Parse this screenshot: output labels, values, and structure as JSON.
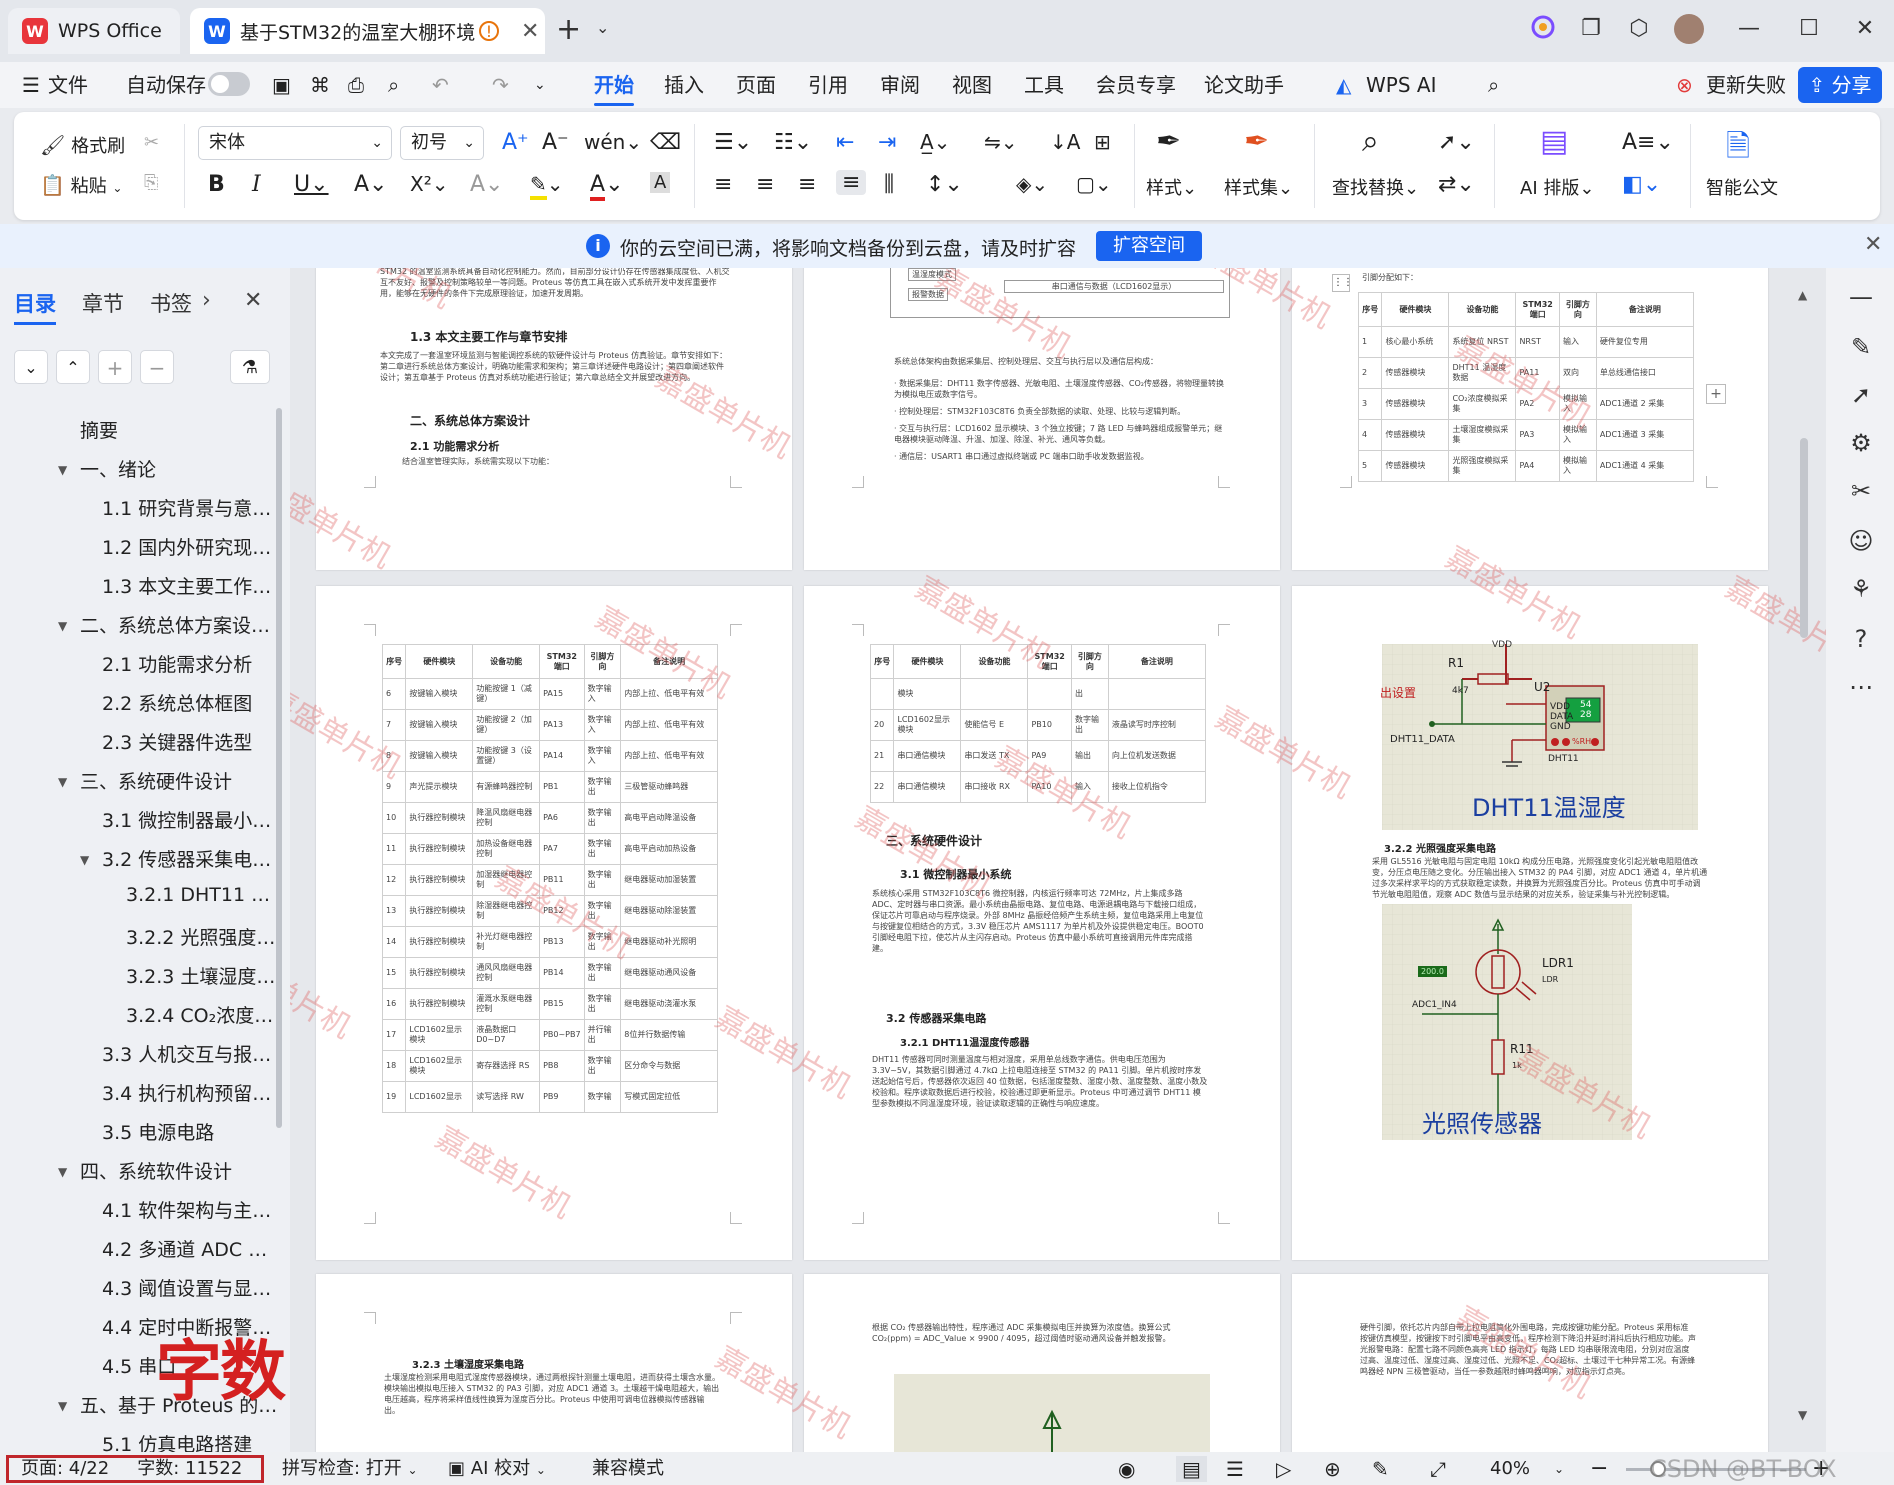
{
  "titlebar": {
    "app_tab_label": "WPS Office",
    "doc_tab_label": "基于STM32的温室大棚环境",
    "new_tab_symbol": "+",
    "dropdown_symbol": "⌄",
    "brand_color": "#e8353b",
    "doc_icon_color": "#1a64f0"
  },
  "menubar": {
    "file_label": "文件",
    "autosave_label": "自动保存",
    "items": [
      "开始",
      "插入",
      "页面",
      "引用",
      "审阅",
      "视图",
      "工具",
      "会员专享",
      "论文助手"
    ],
    "active_item": "开始",
    "wps_ai_label": "WPS AI",
    "update_fail_label": "更新失败",
    "share_label": "分享"
  },
  "ribbon": {
    "format_painter_label": "格式刷",
    "paste_label": "粘贴",
    "font_name": "宋体",
    "font_size": "初号",
    "styles_label": "样式",
    "style_set_label": "样式集",
    "find_replace_label": "查找替换",
    "ai_layout_label": "AI 排版",
    "smart_doc_label": "智能公文"
  },
  "notice": {
    "message": "你的云空间已满，将影响文档备份到云盘，请及时扩容",
    "action_label": "扩容空间"
  },
  "sidebar": {
    "tabs": [
      "目录",
      "章节",
      "书签"
    ],
    "active_tab": "目录",
    "toc": [
      {
        "label": "摘要",
        "level": 0,
        "expander": ""
      },
      {
        "label": "一、绪论",
        "level": 0,
        "expander": "▼"
      },
      {
        "label": "1.1 研究背景与意…",
        "level": 1,
        "expander": ""
      },
      {
        "label": "1.2 国内外研究现…",
        "level": 1,
        "expander": ""
      },
      {
        "label": "1.3 本文主要工作…",
        "level": 1,
        "expander": ""
      },
      {
        "label": "二、系统总体方案设…",
        "level": 0,
        "expander": "▼"
      },
      {
        "label": "2.1 功能需求分析",
        "level": 1,
        "expander": ""
      },
      {
        "label": "2.2 系统总体框图",
        "level": 1,
        "expander": ""
      },
      {
        "label": "2.3 关键器件选型",
        "level": 1,
        "expander": ""
      },
      {
        "label": "三、系统硬件设计",
        "level": 0,
        "expander": "▼"
      },
      {
        "label": "3.1 微控制器最小…",
        "level": 1,
        "expander": ""
      },
      {
        "label": "3.2 传感器采集电…",
        "level": 1,
        "expander": "▼"
      },
      {
        "label": "3.2.1 DHT11 …",
        "level": 2,
        "expander": ""
      },
      {
        "label": "3.2.2 光照强度…",
        "level": 2,
        "expander": ""
      },
      {
        "label": "3.2.3 土壤湿度…",
        "level": 2,
        "expander": ""
      },
      {
        "label": "3.2.4 CO₂浓度…",
        "level": 2,
        "expander": ""
      },
      {
        "label": "3.3 人机交互与报…",
        "level": 1,
        "expander": ""
      },
      {
        "label": "3.4 执行机构预留…",
        "level": 1,
        "expander": ""
      },
      {
        "label": "3.5 电源电路",
        "level": 1,
        "expander": ""
      },
      {
        "label": "四、系统软件设计",
        "level": 0,
        "expander": "▼"
      },
      {
        "label": "4.1 软件架构与主…",
        "level": 1,
        "expander": ""
      },
      {
        "label": "4.2 多通道 ADC …",
        "level": 1,
        "expander": ""
      },
      {
        "label": "4.3 阈值设置与显…",
        "level": 1,
        "expander": ""
      },
      {
        "label": "4.4 定时中断报警…",
        "level": 1,
        "expander": ""
      },
      {
        "label": "4.5 串口",
        "level": 1,
        "expander": ""
      },
      {
        "label": "五、基于 Proteus 的…",
        "level": 0,
        "expander": "▼"
      },
      {
        "label": "5.1 仿真电路搭建",
        "level": 1,
        "expander": ""
      }
    ],
    "word_count_overlay": "字数11522",
    "overlay_color": "#d42020"
  },
  "document": {
    "p1": {
      "heading_13": "1.3 本文主要工作与章节安排",
      "heading_2": "二、系统总体方案设计",
      "heading_21": "2.1 功能需求分析",
      "line_21": "结合温室管理实际，系统需实现以下功能："
    },
    "p2": {
      "box1": "温湿度模式",
      "box2": "报警数据",
      "box3": "串口通信与数据（LCD1602显示）",
      "summary": "系统总体架构由数据采集层、控制处理层、交互与执行层以及通信层构成：",
      "bullets": [
        "· 数据采集层：DHT11 数字传感器、光敏电阻、土壤湿度传感器、CO₂传感器，将物理量转换为模拟电压或数字信号。",
        "· 控制处理层：STM32F103C8T6 负责全部数据的读取、处理、比较与逻辑判断。",
        "· 交互与执行层：LCD1602 显示模块、3 个独立按键；7 路 LED 与蜂鸣器组成报警单元；继电器模块驱动降温、升温、加湿、除湿、补光、通风等负载。",
        "· 通信层：USART1 串口通过虚拟终端或 PC 端串口助手收发数据监视。"
      ]
    },
    "p3": {
      "intro": "引脚分配如下：",
      "headers": [
        "序号",
        "硬件模块",
        "设备功能",
        "STM32端口",
        "引脚方向",
        "备注说明"
      ],
      "rows": [
        [
          "1",
          "核心最小系统",
          "系统复位 NRST",
          "NRST",
          "输入",
          "硬件复位专用"
        ],
        [
          "2",
          "传感器模块",
          "DHT11 温湿度数据",
          "PA11",
          "双向",
          "单总线通信接口"
        ],
        [
          "3",
          "传感器模块",
          "CO₂浓度模拟采集",
          "PA2",
          "模拟输入",
          "ADC1通道 2 采集"
        ],
        [
          "4",
          "传感器模块",
          "土壤湿度模拟采集",
          "PA3",
          "模拟输入",
          "ADC1通道 3 采集"
        ],
        [
          "5",
          "传感器模块",
          "光照强度模拟采集",
          "PA4",
          "模拟输入",
          "ADC1通道 4 采集"
        ]
      ]
    },
    "p4": {
      "headers": [
        "序号",
        "硬件模块",
        "设备功能",
        "STM32端口",
        "引脚方向",
        "备注说明"
      ],
      "rows": [
        [
          "6",
          "按键输入模块",
          "功能按键 1（减键）",
          "PA15",
          "数字输入",
          "内部上拉、低电平有效"
        ],
        [
          "7",
          "按键输入模块",
          "功能按键 2（加键）",
          "PA13",
          "数字输入",
          "内部上拉、低电平有效"
        ],
        [
          "8",
          "按键输入模块",
          "功能按键 3（设置键）",
          "PA14",
          "数字输入",
          "内部上拉、低电平有效"
        ],
        [
          "9",
          "声光提示模块",
          "有源蜂鸣器控制",
          "PB1",
          "数字输出",
          "三极管驱动蜂鸣器"
        ],
        [
          "10",
          "执行器控制模块",
          "降温风扇继电器控制",
          "PA6",
          "数字输出",
          "高电平启动降温设备"
        ],
        [
          "11",
          "执行器控制模块",
          "加热设备继电器控制",
          "PA7",
          "数字输出",
          "高电平启动加热设备"
        ],
        [
          "12",
          "执行器控制模块",
          "加湿器继电器控制",
          "PB11",
          "数字输出",
          "继电器驱动加湿装置"
        ],
        [
          "13",
          "执行器控制模块",
          "除湿器继电器控制",
          "PB12",
          "数字输出",
          "继电器驱动除湿装置"
        ],
        [
          "14",
          "执行器控制模块",
          "补光灯继电器控制",
          "PB13",
          "数字输出",
          "继电器驱动补光照明"
        ],
        [
          "15",
          "执行器控制模块",
          "通风风扇继电器控制",
          "PB14",
          "数字输出",
          "继电器驱动通风设备"
        ],
        [
          "16",
          "执行器控制模块",
          "灌溉水泵继电器控制",
          "PB15",
          "数字输出",
          "继电器驱动浇灌水泵"
        ],
        [
          "17",
          "LCD1602显示模块",
          "液晶数据口 D0~D7",
          "PB0~PB7",
          "并行输出",
          "8位并行数据传输"
        ],
        [
          "18",
          "LCD1602显示模块",
          "寄存器选择 RS",
          "PB8",
          "数字输出",
          "区分命令与数据"
        ],
        [
          "19",
          "LCD1602显示",
          "读写选择 RW",
          "PB9",
          "数字输",
          "写模式固定拉低"
        ]
      ]
    },
    "p5": {
      "headers": [
        "序号",
        "硬件模块",
        "设备功能",
        "STM32端口",
        "引脚方向",
        "备注说明"
      ],
      "rows": [
        [
          "",
          "模块",
          "",
          "",
          "出",
          ""
        ],
        [
          "20",
          "LCD1602显示模块",
          "使能信号 E",
          "PB10",
          "数字输出",
          "液晶读写时序控制"
        ],
        [
          "21",
          "串口通信模块",
          "串口发送 TX",
          "PA9",
          "输出",
          "向上位机发送数据"
        ],
        [
          "22",
          "串口通信模块",
          "串口接收 RX",
          "PA10",
          "输入",
          "接收上位机指令"
        ]
      ],
      "heading_3": "三、系统硬件设计",
      "heading_31": "3.1 微控制器最小系统",
      "heading_32": "3.2 传感器采集电路",
      "heading_321": "3.2.1 DHT11温湿度传感器"
    },
    "p6": {
      "schem_vdd": "VDD",
      "schem_r1": "R1",
      "schem_r1_val": "4k7",
      "schem_u2": "U2",
      "schem_pins": [
        "VDD",
        "DATA",
        "GND"
      ],
      "schem_dht_label": "DHT11",
      "schem_net": "DHT11_DATA",
      "schem_setting": "出设置",
      "schem_reading_1": "54",
      "schem_reading_2": "28",
      "schem_rh": "%RH",
      "caption_dht": "DHT11温湿度",
      "heading_322": "3.2.2 光照强度采集电路",
      "ldr_label": "LDR1",
      "ldr_sub": "LDR",
      "ldr_value": "200.0",
      "adc_net": "ADC1_IN4",
      "r11": "R11",
      "r11_val": "1k",
      "caption_light": "光照传感器"
    },
    "p7": {
      "heading_323": "3.2.3 土壤湿度采集电路"
    },
    "watermark_text": "嘉盛单片机"
  },
  "statusbar": {
    "page_info": "页面: 4/22",
    "word_count": "字数: 11522",
    "spell_check": "拼写检查: 打开",
    "ai_proof": "AI 校对",
    "compat_mode": "兼容模式",
    "zoom": "40%",
    "credit": "CSDN @BT-BOX",
    "highlight_color": "#c0262b"
  }
}
